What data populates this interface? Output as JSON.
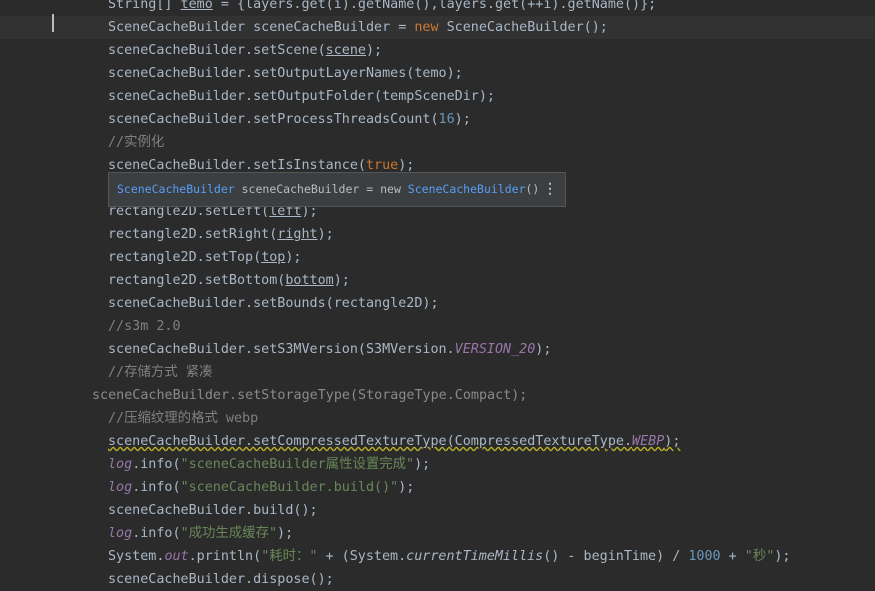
{
  "editor": {
    "lines": [
      {
        "indent": 13,
        "tokens": [
          [
            "String[] ",
            "def"
          ],
          [
            "temo",
            "def-u"
          ],
          [
            " = {layers.get(i).getName(),layers.get(++i).getName()};",
            "def"
          ]
        ]
      },
      {
        "indent": 13,
        "current": true,
        "tokens": [
          [
            "SceneCacheBuilder sceneCacheBuilder = ",
            "def"
          ],
          [
            "new ",
            "kw"
          ],
          [
            "SceneCacheBuilder();",
            "def"
          ]
        ]
      },
      {
        "indent": 13,
        "tokens": [
          [
            "sceneCacheBuilder.setScene(",
            "def"
          ],
          [
            "scene",
            "def-u"
          ],
          [
            ");",
            "def"
          ]
        ]
      },
      {
        "indent": 13,
        "tokens": [
          [
            "sceneCacheBuilder.setOutputLayerNames(temo);",
            "def"
          ]
        ]
      },
      {
        "indent": 13,
        "tokens": [
          [
            "sceneCacheBuilder.setOutputFolder(tempSceneDir);",
            "def"
          ]
        ]
      },
      {
        "indent": 13,
        "tokens": [
          [
            "sceneCacheBuilder.setProcessThreadsCount(",
            "def"
          ],
          [
            "16",
            "num"
          ],
          [
            ");",
            "def"
          ]
        ]
      },
      {
        "indent": 13,
        "tokens": [
          [
            "//实例化",
            "cmt"
          ]
        ]
      },
      {
        "indent": 13,
        "tokens": [
          [
            "sceneCacheBuilder.setIsInstance(",
            "def"
          ],
          [
            "true",
            "kw"
          ],
          [
            ");",
            "def"
          ]
        ]
      },
      {
        "indent": 13,
        "tokens": [
          [
            "",
            "def"
          ]
        ]
      },
      {
        "indent": 13,
        "tokens": [
          [
            "rectangle2D.setLeft(",
            "def"
          ],
          [
            "left",
            "def-u"
          ],
          [
            ");",
            "def"
          ]
        ]
      },
      {
        "indent": 13,
        "tokens": [
          [
            "rectangle2D.setRight(",
            "def"
          ],
          [
            "right",
            "def-u"
          ],
          [
            ");",
            "def"
          ]
        ]
      },
      {
        "indent": 13,
        "tokens": [
          [
            "rectangle2D.setTop(",
            "def"
          ],
          [
            "top",
            "def-u"
          ],
          [
            ");",
            "def"
          ]
        ]
      },
      {
        "indent": 13,
        "tokens": [
          [
            "rectangle2D.setBottom(",
            "def"
          ],
          [
            "bottom",
            "def-u"
          ],
          [
            ");",
            "def"
          ]
        ]
      },
      {
        "indent": 13,
        "tokens": [
          [
            "sceneCacheBuilder.setBounds(rectangle2D);",
            "def"
          ]
        ]
      },
      {
        "indent": 13,
        "tokens": [
          [
            "//s3m 2.0",
            "cmt"
          ]
        ]
      },
      {
        "indent": 13,
        "tokens": [
          [
            "sceneCacheBuilder.setS3MVersion(S3MVersion.",
            "def"
          ],
          [
            "VERSION_20",
            "const"
          ],
          [
            ");",
            "def"
          ]
        ]
      },
      {
        "indent": 13,
        "tokens": [
          [
            "//存储方式 紧凑",
            "cmt"
          ]
        ]
      },
      {
        "indent": 11,
        "tokens": [
          [
            "sceneCacheBuilder.setStorageType(StorageType.Compact);",
            "dim"
          ]
        ]
      },
      {
        "indent": 13,
        "tokens": [
          [
            "//压缩纹理的格式 webp",
            "cmt"
          ]
        ]
      },
      {
        "indent": 13,
        "tokens": [
          [
            "sceneCacheBuilder.setCompressedTextureType(CompressedTextureType.",
            "def-w"
          ],
          [
            "WEBP",
            "const-w"
          ],
          [
            ");",
            "def-w"
          ]
        ]
      },
      {
        "indent": 13,
        "tokens": [
          [
            "log",
            "static"
          ],
          [
            ".info(",
            "def"
          ],
          [
            "\"sceneCacheBuilder属性设置完成\"",
            "str"
          ],
          [
            ");",
            "def"
          ]
        ]
      },
      {
        "indent": 13,
        "tokens": [
          [
            "log",
            "static"
          ],
          [
            ".info(",
            "def"
          ],
          [
            "\"sceneCacheBuilder.build()\"",
            "str"
          ],
          [
            ");",
            "def"
          ]
        ]
      },
      {
        "indent": 13,
        "tokens": [
          [
            "sceneCacheBuilder.build();",
            "def"
          ]
        ]
      },
      {
        "indent": 13,
        "tokens": [
          [
            "log",
            "static"
          ],
          [
            ".info(",
            "def"
          ],
          [
            "\"成功生成缓存\"",
            "str"
          ],
          [
            ");",
            "def"
          ]
        ]
      },
      {
        "indent": 13,
        "tokens": [
          [
            "System.",
            "def"
          ],
          [
            "out",
            "static"
          ],
          [
            ".println(",
            "def"
          ],
          [
            "\"耗时：\"",
            "str"
          ],
          [
            " + (System.",
            "def"
          ],
          [
            "currentTimeMillis",
            "smeth"
          ],
          [
            "() - beginTime) / ",
            "def"
          ],
          [
            "1000",
            "num"
          ],
          [
            " + ",
            "def"
          ],
          [
            "\"秒\"",
            "str"
          ],
          [
            ");",
            "def"
          ]
        ]
      },
      {
        "indent": 13,
        "tokens": [
          [
            "sceneCacheBuilder.dispose();",
            "def"
          ]
        ]
      }
    ]
  },
  "hint_popup": {
    "class_name": "SceneCacheBuilder",
    "middle": " sceneCacheBuilder = new ",
    "ctor": "SceneCacheBuilder",
    "tail": "()",
    "more_icon": "⋮"
  }
}
